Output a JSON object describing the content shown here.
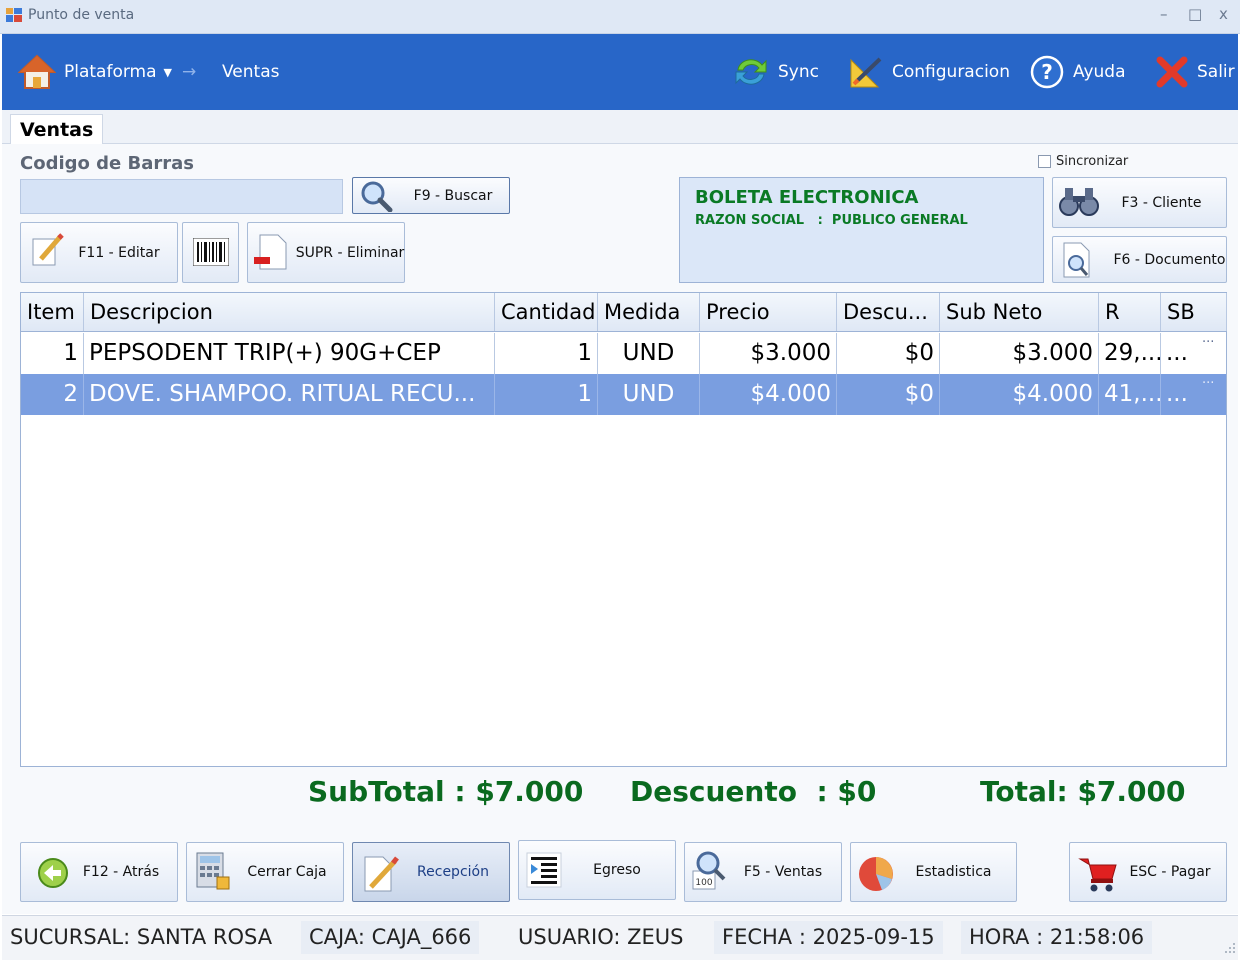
{
  "window": {
    "title": "Punto de venta",
    "minimize": "–",
    "maximize": "□",
    "close": "x"
  },
  "ribbon": {
    "platform": "Plataforma",
    "separator": "→",
    "section": "Ventas",
    "sync": "Sync",
    "config": "Configuracion",
    "help": "Ayuda",
    "exit": "Salir"
  },
  "tab": {
    "label": "Ventas"
  },
  "barcode": {
    "label": "Codigo de Barras",
    "value": "",
    "placeholder": ""
  },
  "buttons": {
    "search": "F9 - Buscar",
    "edit": "F11 - Editar",
    "delete": "SUPR - Eliminar",
    "client": "F3 - Cliente",
    "document": "F6 - Documento"
  },
  "sync_checkbox": {
    "label": "Sincronizar",
    "checked": false
  },
  "document": {
    "type": "BOLETA ELECTRONICA",
    "client_line": "RAZON SOCIAL   :  PUBLICO GENERAL"
  },
  "grid": {
    "columns": [
      "Item",
      "Descripcion",
      "Cantidad",
      "Medida",
      "Precio",
      "Descu...",
      "Sub Neto",
      "R",
      "SB"
    ],
    "rows": [
      {
        "item": "1",
        "descripcion": "PEPSODENT TRIP(+) 90G+CEP",
        "cantidad": "1",
        "medida": "UND",
        "precio": "$3.000",
        "descuento": "$0",
        "subneto": "$3.000",
        "r": "29,...",
        "sb": "...",
        "more": "···",
        "selected": false
      },
      {
        "item": "2",
        "descripcion": "DOVE. SHAMPOO. RITUAL RECU...",
        "cantidad": "1",
        "medida": "UND",
        "precio": "$4.000",
        "descuento": "$0",
        "subneto": "$4.000",
        "r": "41,...",
        "sb": "...",
        "more": "···",
        "selected": true
      }
    ]
  },
  "totals": {
    "subtotal": "SubTotal : $7.000",
    "discount": "Descuento  : $0",
    "total": "Total: $7.000"
  },
  "bottom_buttons": {
    "back": "F12 - Atrás",
    "close_cash": "Cerrar Caja",
    "reception": "Recepción",
    "egress": "Egreso",
    "sales": "F5 - Ventas",
    "stats": "Estadistica",
    "pay": "ESC - Pagar"
  },
  "status": {
    "branch": "SUCURSAL: SANTA ROSA",
    "cash": "CAJA: CAJA_666",
    "user": "USUARIO: ZEUS",
    "date": "FECHA : 2025-09-15",
    "time": "HORA : 21:58:06"
  },
  "colors": {
    "ribbon": "#2866c8",
    "selected_row": "#7a9ee0",
    "totals_text": "#0a6a1f",
    "document_text": "#0a7a25"
  }
}
